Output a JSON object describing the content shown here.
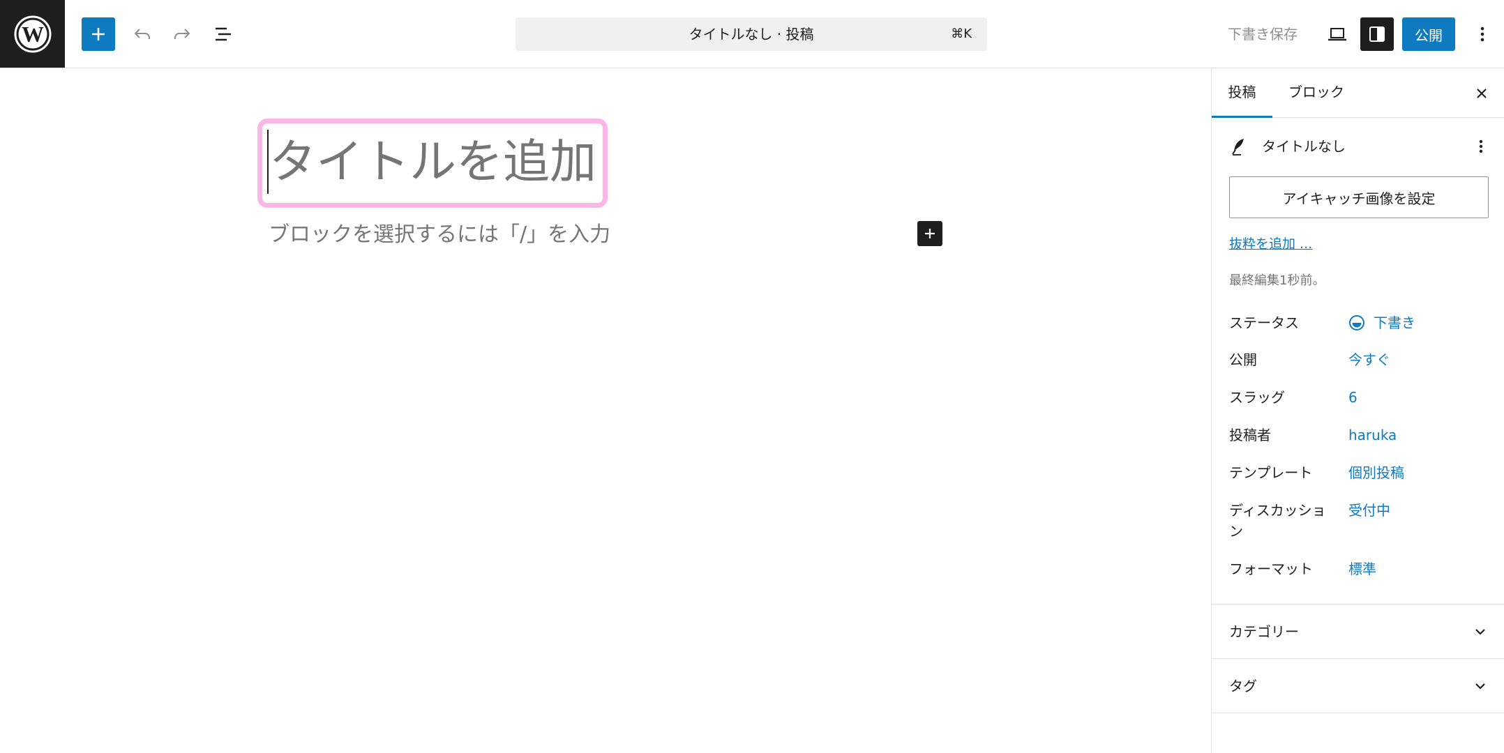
{
  "topbar": {
    "command_title": "タイトルなし · 投稿",
    "command_shortcut": "⌘K",
    "save_draft_label": "下書き保存",
    "publish_label": "公開"
  },
  "editor": {
    "title_placeholder": "タイトルを追加",
    "paragraph_placeholder": "ブロックを選択するには「/」を入力"
  },
  "sidebar": {
    "tabs": [
      "投稿",
      "ブロック"
    ],
    "post_title": "タイトルなし",
    "featured_image_label": "アイキャッチ画像を設定",
    "excerpt_link": "抜粋を追加 ...",
    "last_edited": "最終編集1秒前。",
    "rows": [
      {
        "label": "ステータス",
        "value": "下書き"
      },
      {
        "label": "公開",
        "value": "今すぐ"
      },
      {
        "label": "スラッグ",
        "value": "6"
      },
      {
        "label": "投稿者",
        "value": "haruka"
      },
      {
        "label": "テンプレート",
        "value": "個別投稿"
      },
      {
        "label": "ディスカッション",
        "value": "受付中"
      },
      {
        "label": "フォーマット",
        "value": "標準"
      }
    ],
    "panels": [
      "カテゴリー",
      "タグ"
    ]
  },
  "colors": {
    "accent": "#0e7ac0",
    "dark": "#1e1e1e",
    "title_highlight": "#fbb6e8"
  },
  "icons": [
    "wordpress-logo-icon",
    "plus-icon",
    "undo-icon",
    "redo-icon",
    "list-view-icon",
    "desktop-preview-icon",
    "sidebar-toggle-icon",
    "more-vertical-icon",
    "close-icon",
    "feather-post-icon",
    "status-draft-icon",
    "chevron-down-icon"
  ]
}
